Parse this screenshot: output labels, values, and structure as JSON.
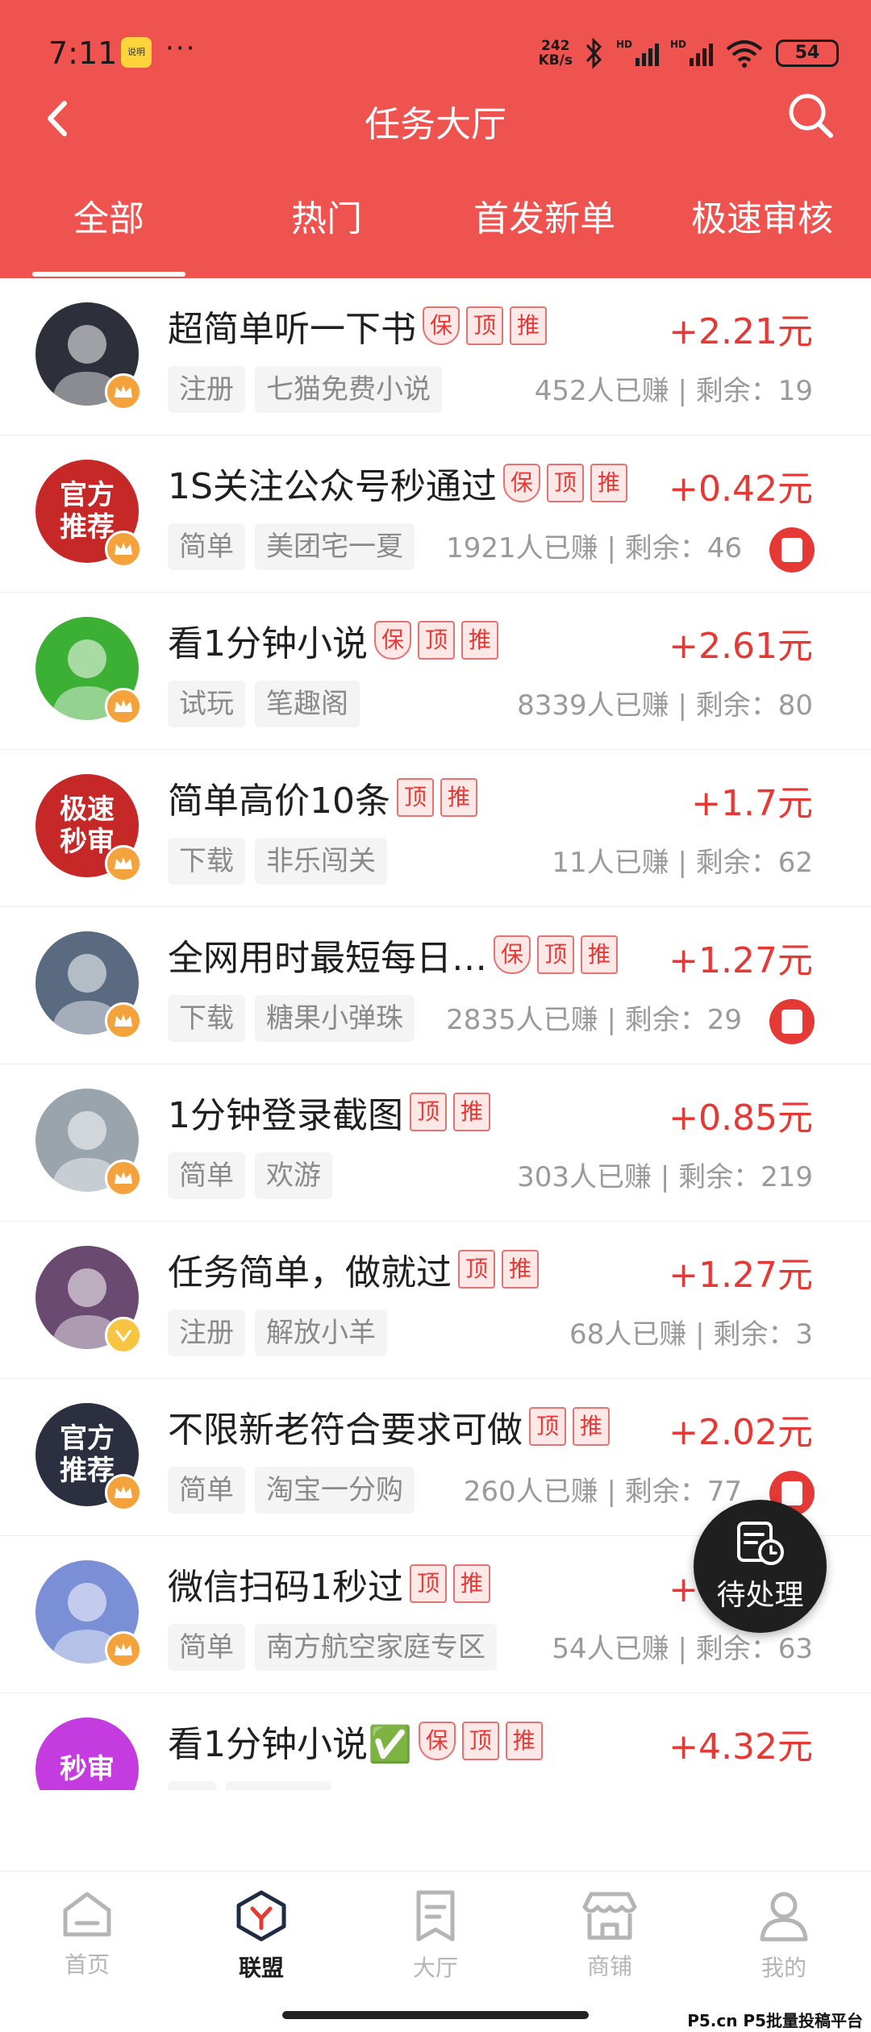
{
  "status_bar": {
    "time": "7:11",
    "app_icon_label": "说明",
    "dots": "···",
    "net_speed_value": "242",
    "net_speed_unit": "KB/s",
    "signal_label": "HD",
    "battery": "54"
  },
  "header": {
    "title": "任务大厅",
    "back_icon": "back-arrow-icon",
    "search_icon": "search-icon",
    "tabs": [
      {
        "label": "全部",
        "active": true
      },
      {
        "label": "热门",
        "active": false
      },
      {
        "label": "首发新单",
        "active": false
      },
      {
        "label": "极速审核",
        "active": false
      }
    ]
  },
  "tasks": [
    {
      "title": "超简单听一下书",
      "badges": [
        "保",
        "顶",
        "推"
      ],
      "reward": "+2.21元",
      "tags": [
        "注册",
        "七猫免费小说"
      ],
      "stats": "452人已赚 | 剩余：19",
      "avatar_text": "",
      "avatar_color": "#2d2f3a",
      "red_packet": false,
      "crown": "crown"
    },
    {
      "title": "1S关注公众号秒通过",
      "badges": [
        "保",
        "顶",
        "推"
      ],
      "reward": "+0.42元",
      "tags": [
        "简单",
        "美团宅一夏"
      ],
      "stats": "1921人已赚 | 剩余：46",
      "avatar_text": "官方\n推荐",
      "avatar_color": "#c62828",
      "red_packet": true,
      "crown": "crown"
    },
    {
      "title": "看1分钟小说",
      "badges": [
        "保",
        "顶",
        "推"
      ],
      "reward": "+2.61元",
      "tags": [
        "试玩",
        "笔趣阁"
      ],
      "stats": "8339人已赚 | 剩余：80",
      "avatar_text": "",
      "avatar_color": "#3cb034",
      "red_packet": false,
      "crown": "crown"
    },
    {
      "title": "简单高价10条",
      "badges": [
        "顶",
        "推"
      ],
      "reward": "+1.7元",
      "tags": [
        "下载",
        "非乐闯关"
      ],
      "stats": "11人已赚 | 剩余：62",
      "avatar_text": "极速\n秒审",
      "avatar_color": "#c62828",
      "red_packet": false,
      "crown": "crown"
    },
    {
      "title": "全网用时最短每日…",
      "badges": [
        "保",
        "顶",
        "推"
      ],
      "reward": "+1.27元",
      "tags": [
        "下载",
        "糖果小弹珠"
      ],
      "stats": "2835人已赚 | 剩余：29",
      "avatar_text": "",
      "avatar_color": "#5a6a80",
      "red_packet": true,
      "crown": "crown"
    },
    {
      "title": "1分钟登录截图",
      "badges": [
        "顶",
        "推"
      ],
      "reward": "+0.85元",
      "tags": [
        "简单",
        "欢游"
      ],
      "stats": "303人已赚 | 剩余：219",
      "avatar_text": "",
      "avatar_color": "#9aa4ad",
      "red_packet": false,
      "crown": "crown"
    },
    {
      "title": "任务简单，做就过",
      "badges": [
        "顶",
        "推"
      ],
      "reward": "+1.27元",
      "tags": [
        "注册",
        "解放小羊"
      ],
      "stats": "68人已赚 | 剩余：3",
      "avatar_text": "",
      "avatar_color": "#6b4a72",
      "red_packet": false,
      "crown": "vip"
    },
    {
      "title": "不限新老符合要求可做",
      "badges": [
        "顶",
        "推"
      ],
      "reward": "+2.02元",
      "tags": [
        "简单",
        "淘宝一分购"
      ],
      "stats": "260人已赚 | 剩余：77",
      "avatar_text": "官方\n推荐",
      "avatar_color": "#2b2f40",
      "red_packet": true,
      "crown": "crown"
    },
    {
      "title": "微信扫码1秒过",
      "badges": [
        "顶",
        "推"
      ],
      "reward": "+1.02元",
      "tags": [
        "简单",
        "南方航空家庭专区"
      ],
      "stats": "54人已赚 | 剩余：63",
      "avatar_text": "",
      "avatar_color": "#7b8fd6",
      "red_packet": false,
      "crown": "crown"
    },
    {
      "title": "看1分钟小说✅",
      "badges": [
        "保",
        "顶",
        "推"
      ],
      "reward": "+4.32元",
      "tags": [
        "",
        ""
      ],
      "stats": "",
      "avatar_text": "秒审",
      "avatar_color": "#c43be0",
      "red_packet": false,
      "crown": ""
    }
  ],
  "fab": {
    "label": "待处理",
    "icon": "pending-clock-icon"
  },
  "bottom_nav": [
    {
      "label": "首页",
      "icon": "home-icon",
      "active": false
    },
    {
      "label": "联盟",
      "icon": "alliance-icon",
      "active": true
    },
    {
      "label": "大厅",
      "icon": "hall-bookmark-icon",
      "active": false
    },
    {
      "label": "商铺",
      "icon": "shop-icon",
      "active": false
    },
    {
      "label": "我的",
      "icon": "profile-icon",
      "active": false
    }
  ],
  "watermark": "P5.cn P5批量投稿平台",
  "colors": {
    "brand": "#ef5350",
    "reward": "#e53935",
    "tag_bg": "#f4f4f4"
  }
}
